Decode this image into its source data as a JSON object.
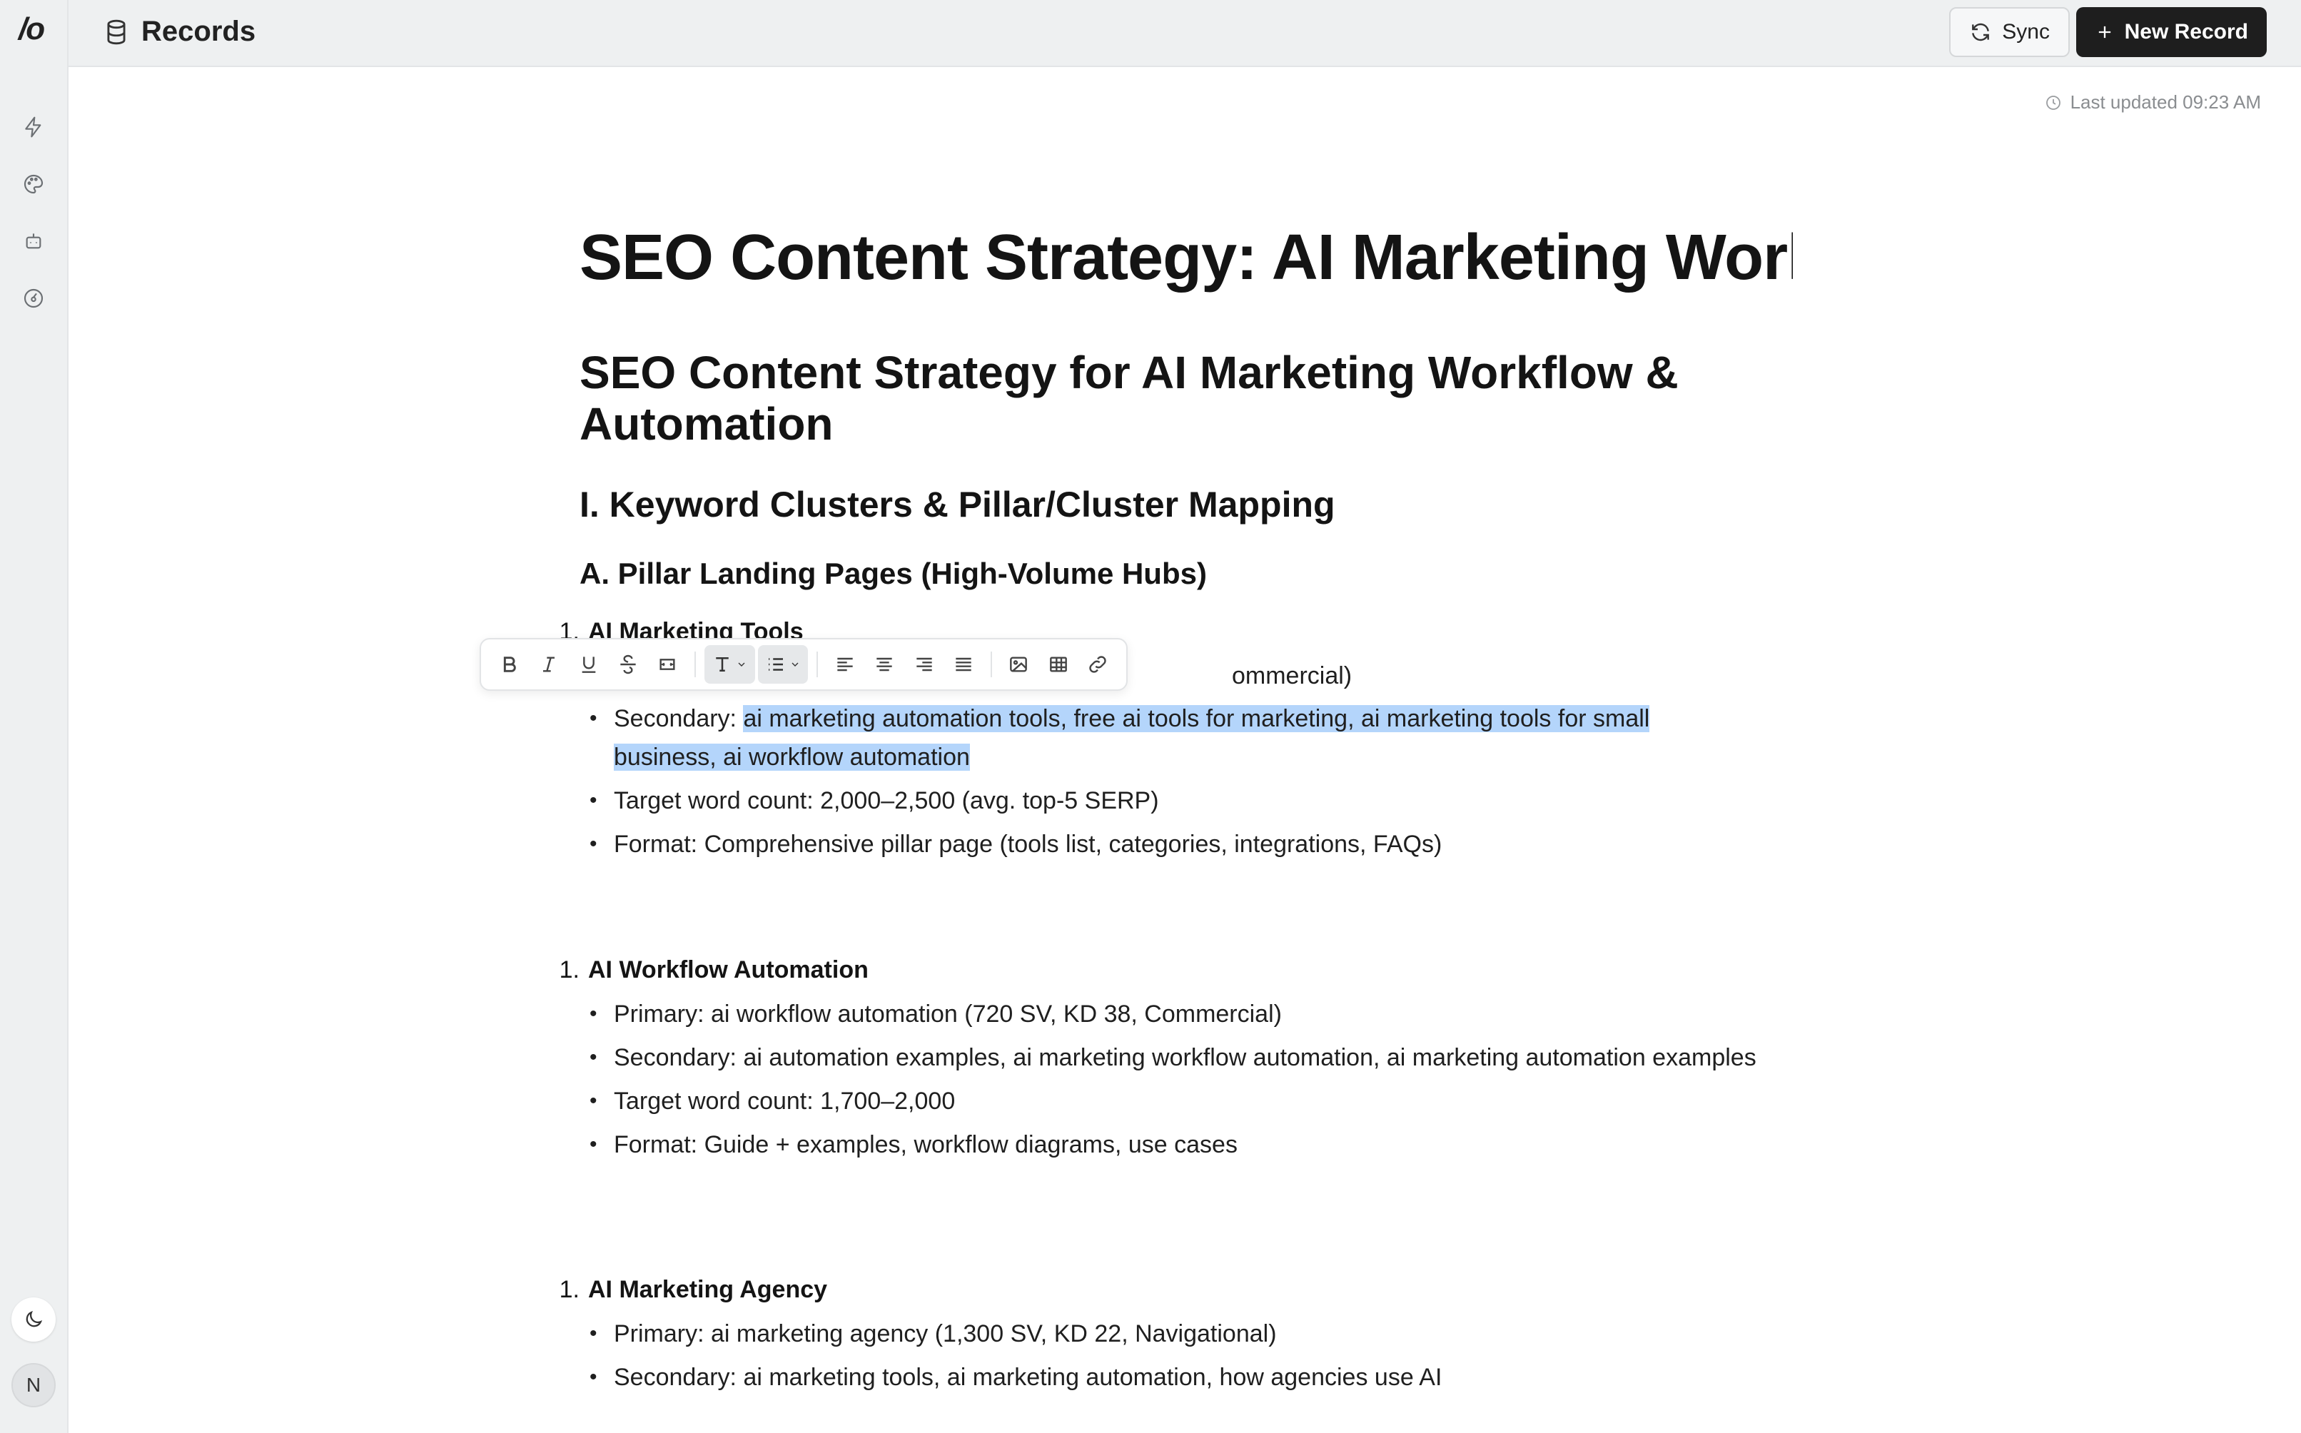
{
  "app": {
    "logo": "/o",
    "title": "Records"
  },
  "topbar": {
    "sync_label": "Sync",
    "new_label": "New Record"
  },
  "status": {
    "last_updated": "Last updated 09:23 AM"
  },
  "sidebar": {
    "icons": [
      "bolt-icon",
      "palette-icon",
      "robot-icon",
      "gauge-icon"
    ],
    "avatar_initial": "N"
  },
  "doc": {
    "title": "SEO Content Strategy: AI Marketing Workflow",
    "h1": "SEO Content Strategy for AI Marketing Workflow & Automation",
    "h2": "I. Keyword Clusters & Pillar/Cluster Mapping",
    "h3": "A. Pillar Landing Pages (High-Volume Hubs)",
    "sections": [
      {
        "number": "1.",
        "title": "AI Marketing Tools",
        "primary_tail": "ommercial)",
        "secondary_prefix": "Secondary: ",
        "secondary_selected": "ai marketing automation tools, free ai tools for marketing, ai marketing tools for small business, ai workflow automation",
        "target": "Target word count: 2,000–2,500 (avg. top-5 SERP)",
        "format": "Format: Comprehensive pillar page (tools list, categories, integrations, FAQs)"
      },
      {
        "number": "1.",
        "title": "AI Workflow Automation",
        "primary": "Primary: ai workflow automation (720 SV, KD 38, Commercial)",
        "secondary": "Secondary: ai automation examples, ai marketing workflow automation, ai marketing automation examples",
        "target": "Target word count: 1,700–2,000",
        "format": "Format: Guide + examples, workflow diagrams, use cases"
      },
      {
        "number": "1.",
        "title": "AI Marketing Agency",
        "primary": "Primary: ai marketing agency (1,300 SV, KD 22, Navigational)",
        "secondary": "Secondary: ai marketing tools, ai marketing automation, how agencies use AI"
      }
    ]
  },
  "toolbar": {
    "buttons": [
      "bold-icon",
      "italic-icon",
      "underline-icon",
      "strikethrough-icon",
      "code-icon",
      "text-style-dropdown",
      "list-dropdown",
      "align-left-icon",
      "align-center-icon",
      "align-right-icon",
      "align-justify-icon",
      "image-icon",
      "table-icon",
      "link-icon"
    ]
  },
  "colors": {
    "selection": "#b4d5fb",
    "primary_button": "#1e1e1e",
    "sidebar_bg": "#eef0f1"
  }
}
